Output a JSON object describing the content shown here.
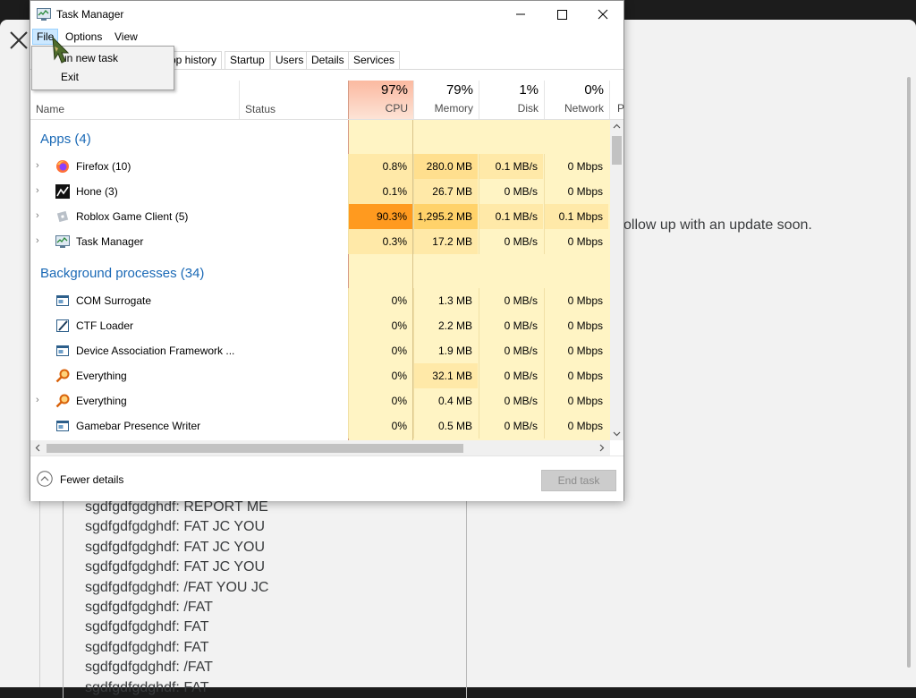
{
  "background": {
    "right_text": "ollow up with an update soon.",
    "chat_lines": [
      "sgdfgdfgdghdf: REPORT ME",
      "sgdfgdfgdghdf: FAT JC YOU",
      "sgdfgdfgdghdf: FAT JC YOU",
      "sgdfgdfgdghdf: FAT JC YOU",
      "sgdfgdfgdghdf: /FAT YOU JC",
      "sgdfgdfgdghdf: /FAT",
      "sgdfgdfgdghdf: FAT",
      "sgdfgdfgdghdf: FAT",
      "sgdfgdfgdghdf: /FAT",
      "sgdfgdfgdghdf: FAT"
    ]
  },
  "task_manager": {
    "title": "Task Manager",
    "menu": {
      "file": "File",
      "options": "Options",
      "view": "View"
    },
    "file_menu": {
      "run_new_task": "un new task",
      "exit": "Exit"
    },
    "tabs": [
      "pp history",
      "Startup",
      "Users",
      "Details",
      "Services"
    ],
    "header": {
      "name": "Name",
      "status": "Status",
      "cpu": {
        "pct": "97%",
        "label": "CPU"
      },
      "memory": {
        "pct": "79%",
        "label": "Memory"
      },
      "disk": {
        "pct": "1%",
        "label": "Disk"
      },
      "network": {
        "pct": "0%",
        "label": "Network"
      },
      "power": {
        "label": "P"
      }
    },
    "groups": {
      "apps": "Apps (4)",
      "background": "Background processes (34)"
    },
    "apps": [
      {
        "name": "Firefox (10)",
        "icon": "firefox-icon",
        "cpu": "0.8%",
        "memory": "280.0 MB",
        "disk": "0.1 MB/s",
        "network": "0 Mbps"
      },
      {
        "name": "Hone (3)",
        "icon": "hone-icon",
        "cpu": "0.1%",
        "memory": "26.7 MB",
        "disk": "0 MB/s",
        "network": "0 Mbps"
      },
      {
        "name": "Roblox Game Client (5)",
        "icon": "roblox-icon",
        "cpu": "90.3%",
        "memory": "1,295.2 MB",
        "disk": "0.1 MB/s",
        "network": "0.1 Mbps"
      },
      {
        "name": "Task Manager",
        "icon": "task-manager-icon",
        "cpu": "0.3%",
        "memory": "17.2 MB",
        "disk": "0 MB/s",
        "network": "0 Mbps"
      }
    ],
    "background_processes": [
      {
        "name": "COM Surrogate",
        "icon": "window-icon",
        "cpu": "0%",
        "memory": "1.3 MB",
        "disk": "0 MB/s",
        "network": "0 Mbps"
      },
      {
        "name": "CTF Loader",
        "icon": "pen-icon",
        "cpu": "0%",
        "memory": "2.2 MB",
        "disk": "0 MB/s",
        "network": "0 Mbps"
      },
      {
        "name": "Device Association Framework ...",
        "icon": "window-icon",
        "cpu": "0%",
        "memory": "1.9 MB",
        "disk": "0 MB/s",
        "network": "0 Mbps"
      },
      {
        "name": "Everything",
        "icon": "magnifier-icon",
        "cpu": "0%",
        "memory": "32.1 MB",
        "disk": "0 MB/s",
        "network": "0 Mbps"
      },
      {
        "name": "Everything",
        "icon": "magnifier-icon",
        "cpu": "0%",
        "memory": "0.4 MB",
        "disk": "0 MB/s",
        "network": "0 Mbps"
      },
      {
        "name": "Gamebar Presence Writer",
        "icon": "window-icon",
        "cpu": "0%",
        "memory": "0.5 MB",
        "disk": "0 MB/s",
        "network": "0 Mbps"
      }
    ],
    "footer": {
      "fewer_details": "Fewer details",
      "end_task": "End task"
    }
  }
}
